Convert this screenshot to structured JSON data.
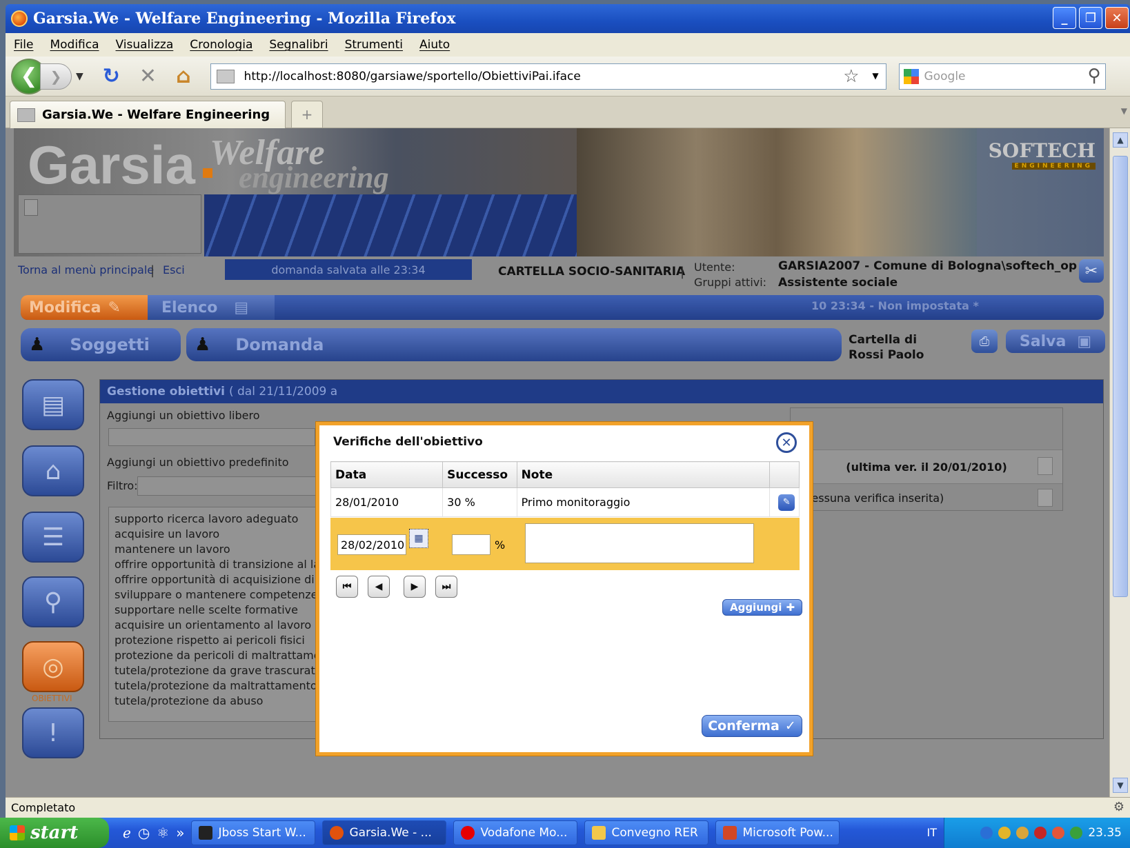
{
  "window": {
    "title": "Garsia.We - Welfare Engineering - Mozilla Firefox",
    "controls": [
      "_",
      "❐",
      "✕"
    ]
  },
  "menu": {
    "items": [
      "File",
      "Modifica",
      "Visualizza",
      "Cronologia",
      "Segnalibri",
      "Strumenti",
      "Aiuto"
    ]
  },
  "nav": {
    "url": "http://localhost:8080/garsiawe/sportello/ObiettiviPai.iface",
    "search_placeholder": "Google"
  },
  "tabs": {
    "active": "Garsia.We - Welfare Engineering",
    "new_tab": "+"
  },
  "banner": {
    "logo": "Garsia",
    "logo_welfare": "Welfare",
    "logo_engineering": "engineering",
    "brand": "SOFTECH",
    "brand_sub": "ENGINEERING"
  },
  "header": {
    "back_link": "Torna al menù principale",
    "exit_link": "Esci",
    "saved_status": "domanda salvata alle 23:34",
    "section_title": "CARTELLA SOCIO-SANITARIA",
    "user_label": "Utente:",
    "user_value": "GARSIA2007 - Comune di Bologna\\softech_op",
    "groups_label": "Gruppi attivi:",
    "groups_value": "Assistente sociale"
  },
  "toolbar": {
    "modifica": "Modifica",
    "elenco": "Elenco",
    "status_right": "10 23:34 - Non impostata *",
    "soggetti": "Soggetti",
    "domanda": "Domanda",
    "cartella_line1": "Cartella di",
    "cartella_line2": "Rossi Paolo",
    "salva": "Salva"
  },
  "sidebar": {
    "obiettivi_label": "OBIETTIVI"
  },
  "panel": {
    "title": "Gestione obiettivi",
    "title_range": "( dal 21/11/2009 a",
    "free_label": "Aggiungi un obiettivo libero",
    "predefined_label": "Aggiungi un obiettivo predefinito",
    "filter_label": "Filtro:",
    "objectives": [
      "supporto ricerca lavoro adeguato",
      "acquisire un lavoro",
      "mantenere un lavoro",
      "offrire opportunità di transizione al lav",
      "offrire opportunità di acquisizione di c",
      "sviluppare o mantenere competenze ",
      "supportare nelle scelte formative",
      "acquisire un orientamento al lavoro re",
      "protezione rispetto ai pericoli fisici",
      "protezione da pericoli di maltrattamento p",
      "tutela/protezione da grave trascuratezza",
      "tutela/protezione da maltrattamento contir",
      "tutela/protezione da abuso"
    ],
    "last_version": "(ultima ver. il 20/01/2010)",
    "no_verification": "(nessuna verifica inserita)"
  },
  "modal": {
    "title": "Verifiche dell'obiettivo",
    "columns": [
      "Data",
      "Successo",
      "Note"
    ],
    "rows": [
      {
        "data": "28/01/2010",
        "successo": "30 %",
        "note": "Primo monitoraggio"
      }
    ],
    "new_row": {
      "date": "28/02/2010",
      "percent": "",
      "pct_sign": "%",
      "note": ""
    },
    "nav_buttons": [
      "⏮",
      "◀",
      "▶",
      "⏭"
    ],
    "add_button": "Aggiungi",
    "confirm_button": "Conferma"
  },
  "status": {
    "text": "Completato"
  },
  "taskbar": {
    "start": "start",
    "tasks": [
      {
        "label": "Jboss Start W...",
        "color": "#222222"
      },
      {
        "label": "Garsia.We - ...",
        "color": "#e1520d",
        "active": true
      },
      {
        "label": "Vodafone Mo...",
        "color": "#e60000"
      },
      {
        "label": "Convegno RER",
        "color": "#f2c84b"
      },
      {
        "label": "Microsoft Pow...",
        "color": "#d24726"
      }
    ],
    "language": "IT",
    "clock": "23.35"
  }
}
